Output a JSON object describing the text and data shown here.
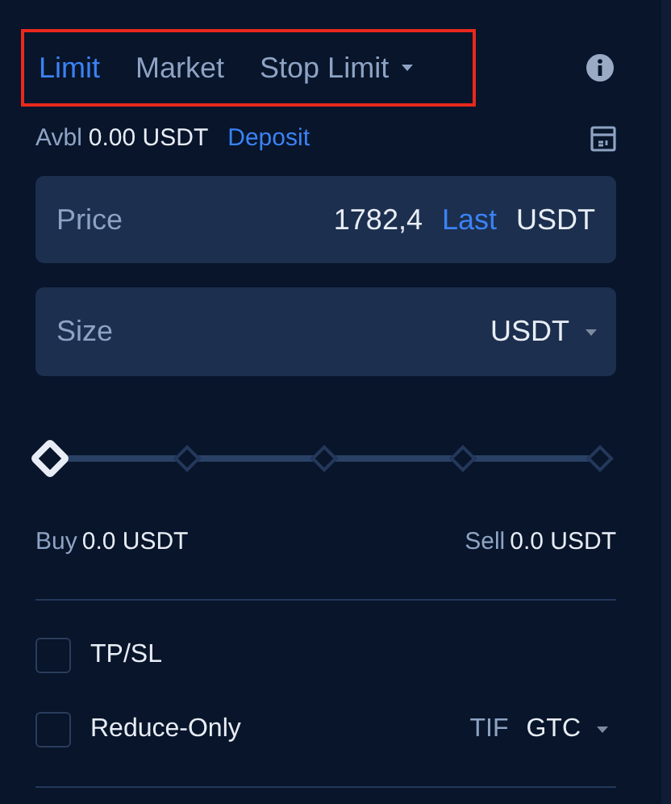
{
  "tabs": [
    {
      "label": "Limit",
      "selected": true,
      "dropdown": false
    },
    {
      "label": "Market",
      "selected": false,
      "dropdown": false
    },
    {
      "label": "Stop Limit",
      "selected": false,
      "dropdown": true
    }
  ],
  "available": {
    "label": "Avbl",
    "value": "0.00 USDT",
    "link": "Deposit"
  },
  "price": {
    "label": "Price",
    "value": "1782,4",
    "link": "Last",
    "unit": "USDT"
  },
  "size": {
    "label": "Size",
    "unit": "USDT"
  },
  "slider": {
    "level": 0
  },
  "buy": {
    "label": "Buy",
    "value": "0.0 USDT"
  },
  "sell": {
    "label": "Sell",
    "value": "0.0 USDT"
  },
  "options": [
    {
      "label": "TP/SL",
      "checked": false
    },
    {
      "label": "Reduce-Only",
      "checked": false
    }
  ],
  "tif": {
    "label": "TIF",
    "value": "GTC"
  }
}
